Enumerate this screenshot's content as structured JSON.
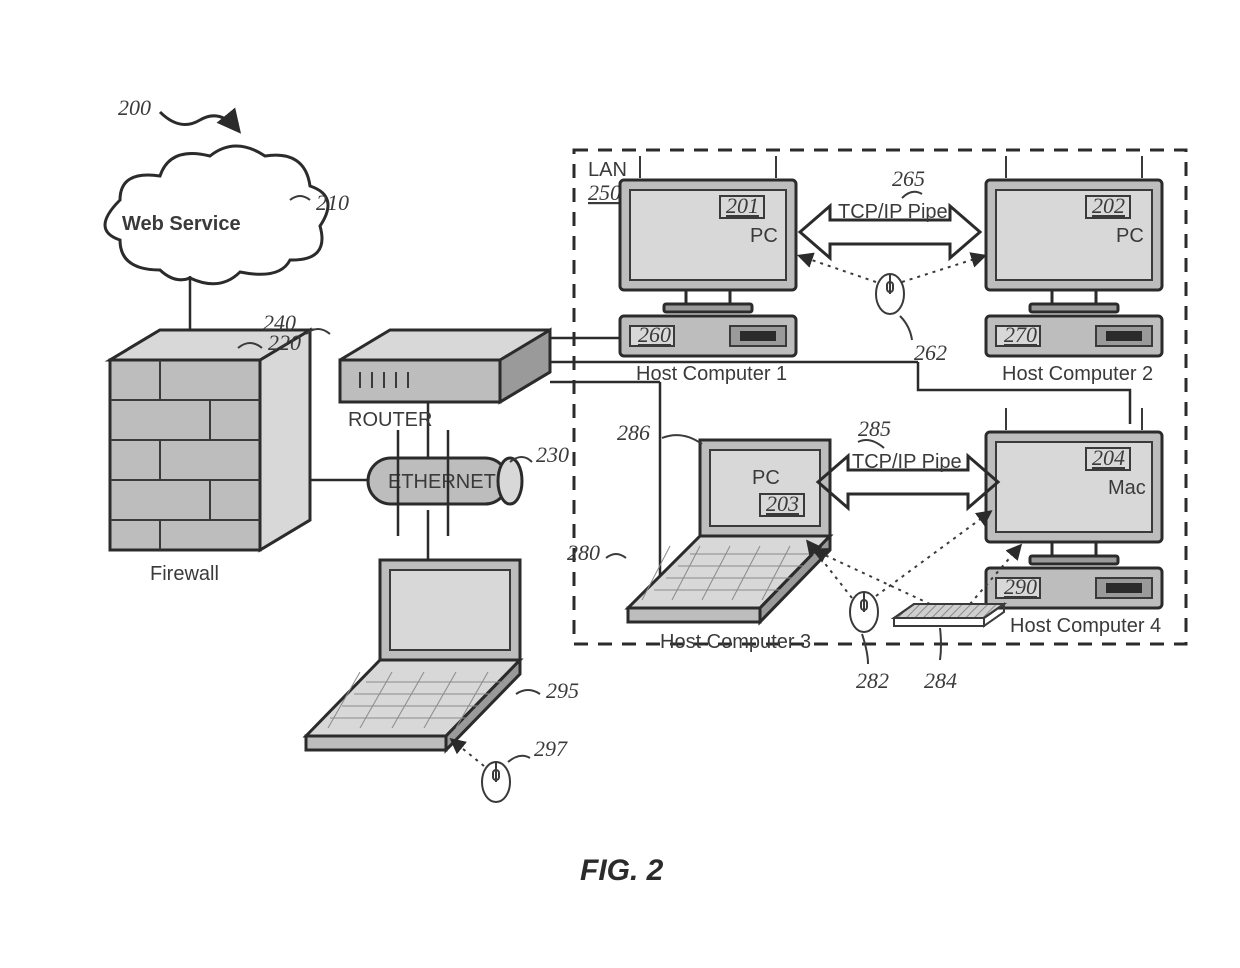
{
  "figure": {
    "number": "200",
    "caption": "FIG. 2"
  },
  "cloud": {
    "label": "Web Service",
    "ref": "210"
  },
  "firewall": {
    "label": "Firewall",
    "ref": "220"
  },
  "ethernet": {
    "label": "ETHERNET",
    "ref": "230"
  },
  "router": {
    "label": "ROUTER",
    "ref": "240"
  },
  "lan": {
    "label": "LAN",
    "ref": "250"
  },
  "hosts": {
    "h1": {
      "label": "Host Computer 1",
      "os": "PC",
      "monitor_ref": "201",
      "tower_ref": "260"
    },
    "h2": {
      "label": "Host Computer 2",
      "os": "PC",
      "monitor_ref": "202",
      "tower_ref": "270"
    },
    "h3": {
      "label": "Host Computer 3",
      "os": "PC",
      "monitor_ref": "203",
      "laptop_ref": "280",
      "screen_ref": "286"
    },
    "h4": {
      "label": "Host Computer 4",
      "os": "Mac",
      "monitor_ref": "204",
      "tower_ref": "290"
    }
  },
  "pipes": {
    "top": {
      "label": "TCP/IP Pipe",
      "ref": "265"
    },
    "bottom": {
      "label": "TCP/IP Pipe",
      "ref": "285"
    }
  },
  "mice": {
    "top": {
      "ref": "262"
    },
    "bottom": {
      "ref": "282"
    },
    "ext": {
      "ref": "297"
    }
  },
  "keyboard": {
    "ref": "284"
  },
  "laptop_ext": {
    "ref": "295"
  }
}
